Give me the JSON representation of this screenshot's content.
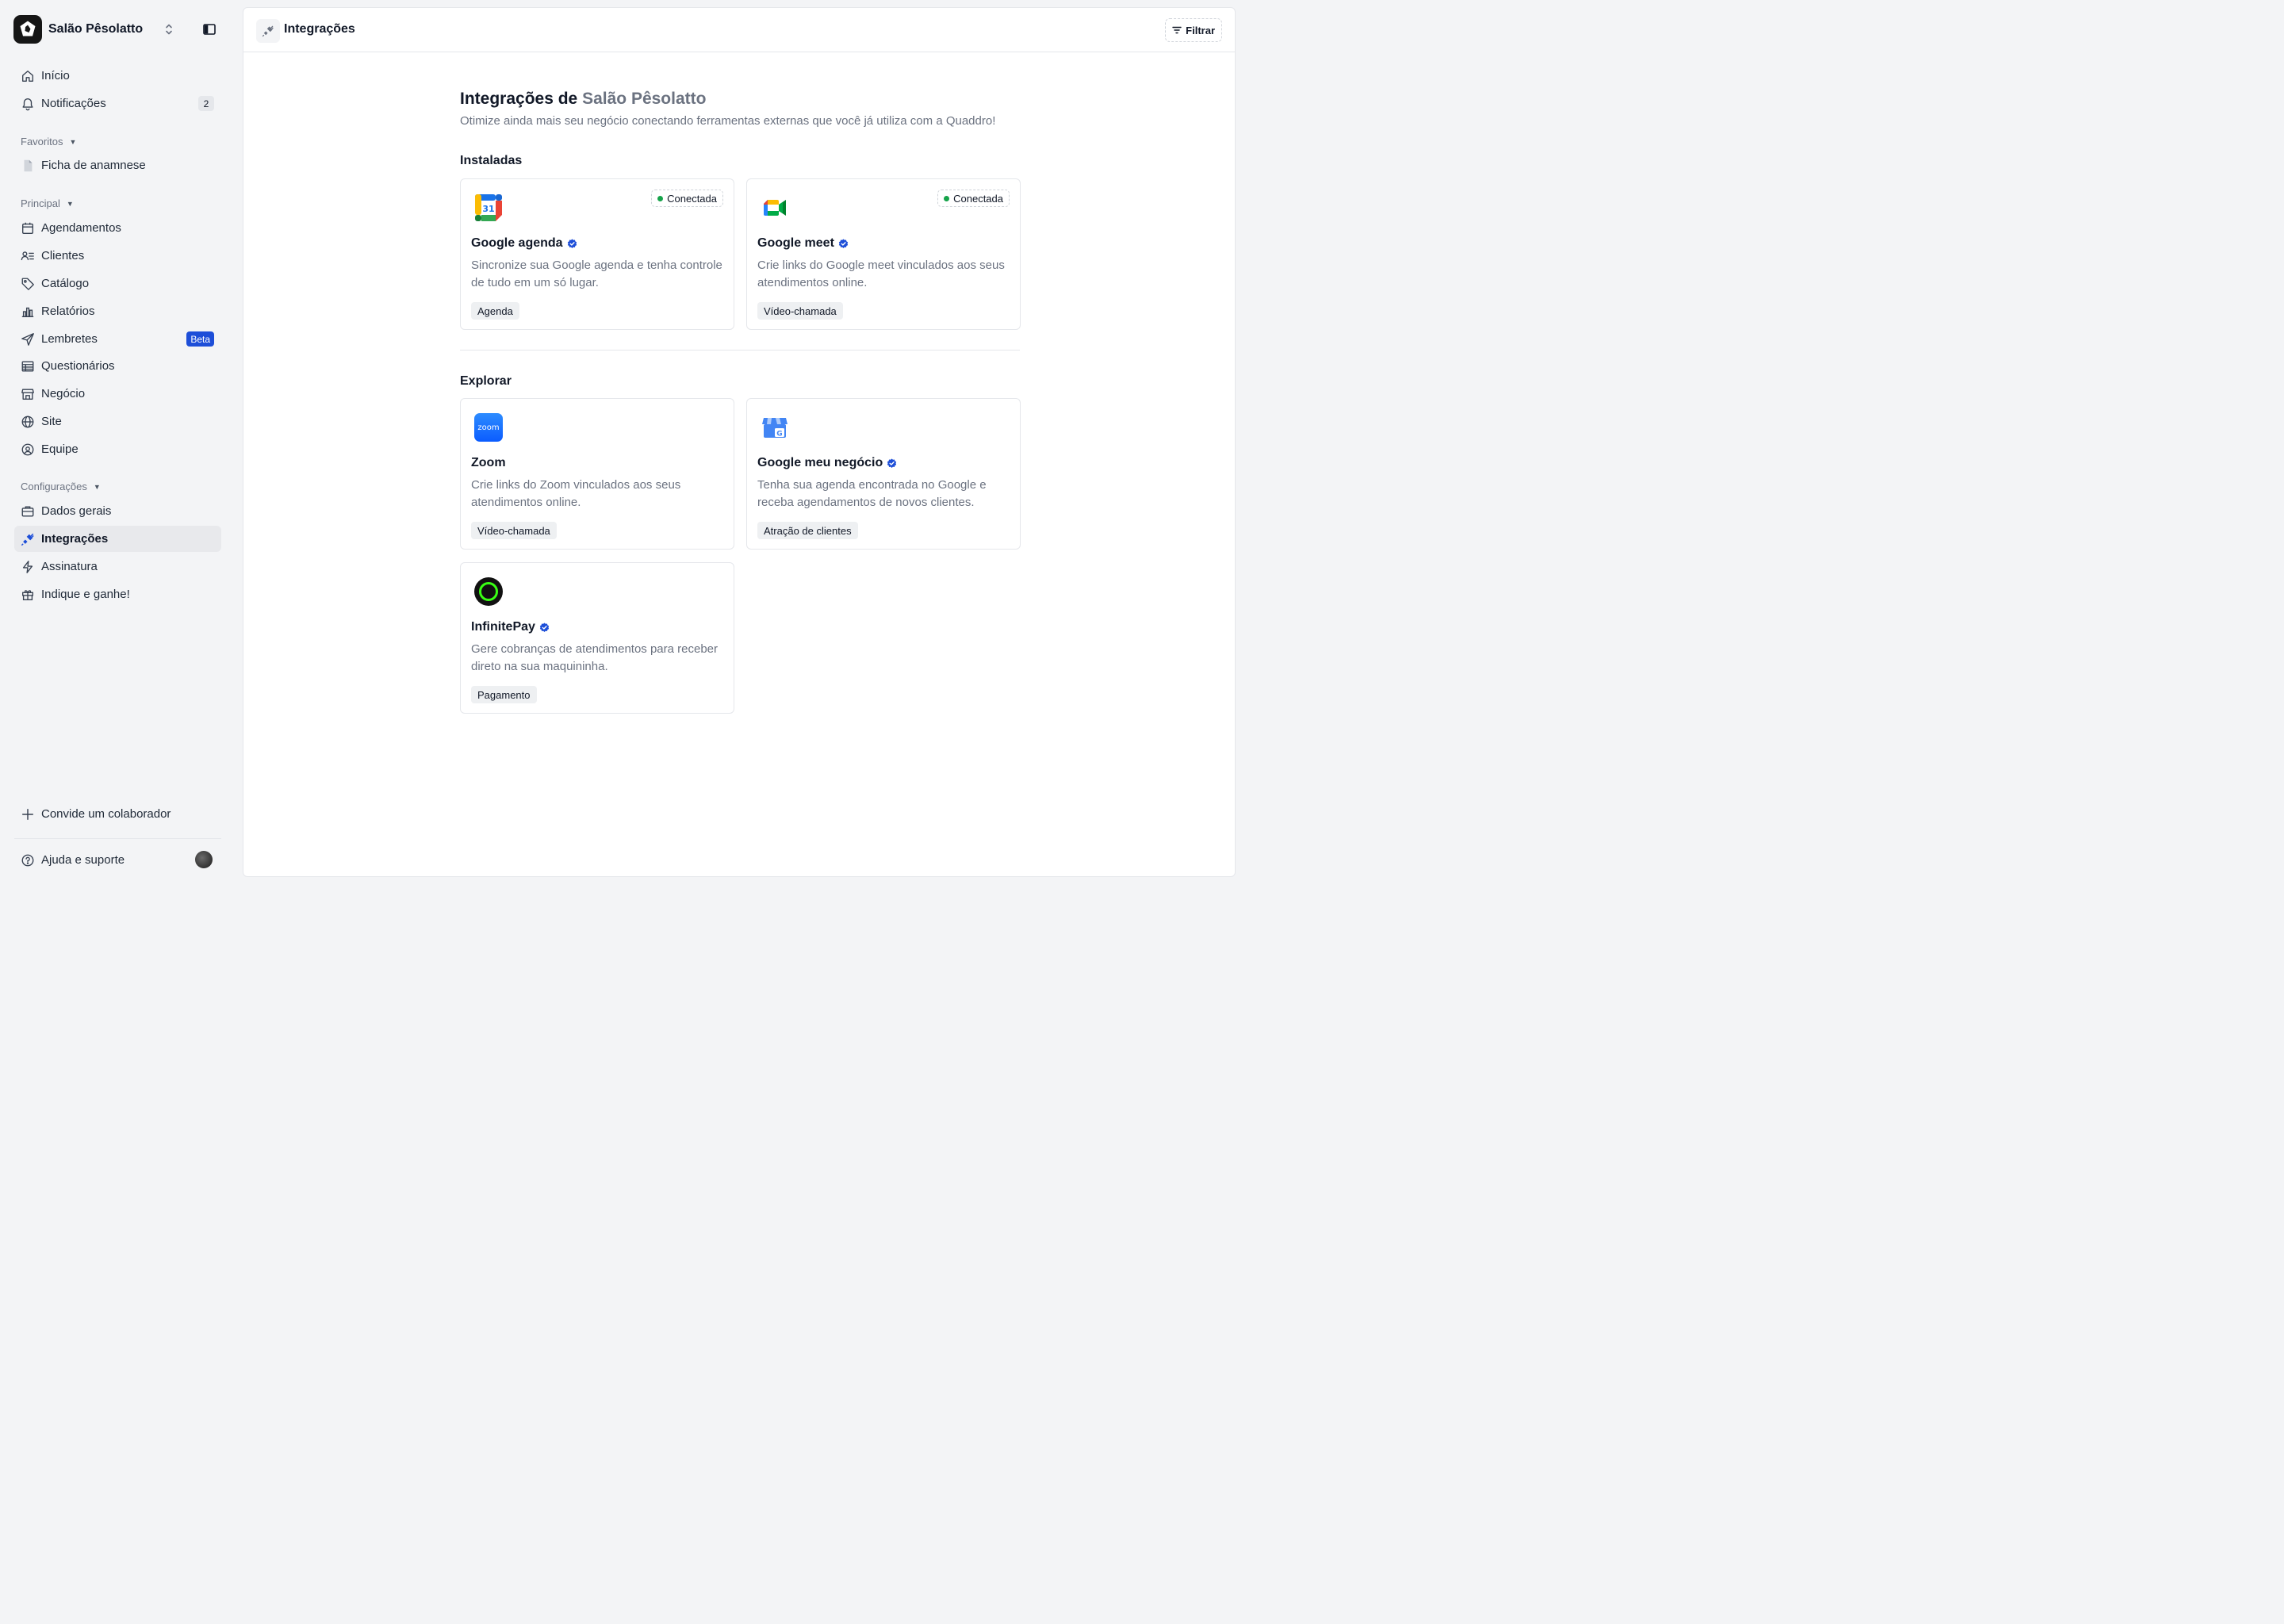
{
  "sidebar": {
    "workspace_name": "Salão Pêsolatto",
    "nav": {
      "inicio": "Início",
      "notificacoes": "Notificações",
      "notificacoes_count": "2"
    },
    "favoritos": {
      "title": "Favoritos",
      "items": [
        "Ficha de anamnese"
      ]
    },
    "principal": {
      "title": "Principal",
      "items": [
        "Agendamentos",
        "Clientes",
        "Catálogo",
        "Relatórios",
        "Lembretes",
        "Questionários",
        "Negócio",
        "Site",
        "Equipe"
      ],
      "beta_badge": "Beta"
    },
    "configuracoes": {
      "title": "Configurações",
      "items": [
        "Dados gerais",
        "Integrações",
        "Assinatura",
        "Indique e ganhe!"
      ]
    },
    "invite": "Convide um colaborador",
    "help": "Ajuda e suporte"
  },
  "header": {
    "title": "Integrações",
    "filter_label": "Filtrar"
  },
  "page": {
    "heading_prefix": "Integrações de",
    "heading_business": "Salão Pêsolatto",
    "subtitle": "Otimize ainda mais seu negócio conectando ferramentas externas que você já utiliza com a Quaddro!",
    "installed_title": "Instaladas",
    "explore_title": "Explorar",
    "connected_label": "Conectada"
  },
  "installed": [
    {
      "name": "Google agenda",
      "description": "Sincronize sua Google agenda e tenha controle de tudo em um só lugar.",
      "tag": "Agenda",
      "icon": "google-calendar-icon"
    },
    {
      "name": "Google meet",
      "description": "Crie links do Google meet vinculados aos seus atendimentos online.",
      "tag": "Vídeo-chamada",
      "icon": "google-meet-icon"
    }
  ],
  "explore": [
    {
      "name": "Zoom",
      "logo_text": "zoom",
      "description": "Crie links do Zoom vinculados aos seus atendimentos online.",
      "tag": "Vídeo-chamada",
      "icon": "zoom-icon"
    },
    {
      "name": "Google meu negócio",
      "description": "Tenha sua agenda encontrada no Google e receba agendamentos de novos clientes.",
      "tag": "Atração de clientes",
      "icon": "google-business-icon"
    },
    {
      "name": "InfinitePay",
      "description": "Gere cobranças de atendimentos para receber direto na sua maquininha.",
      "tag": "Pagamento",
      "icon": "infinitepay-icon"
    }
  ],
  "colors": {
    "accent": "#1d4ed8",
    "connected": "#16a34a",
    "sidebar_bg": "#f3f4f6"
  }
}
